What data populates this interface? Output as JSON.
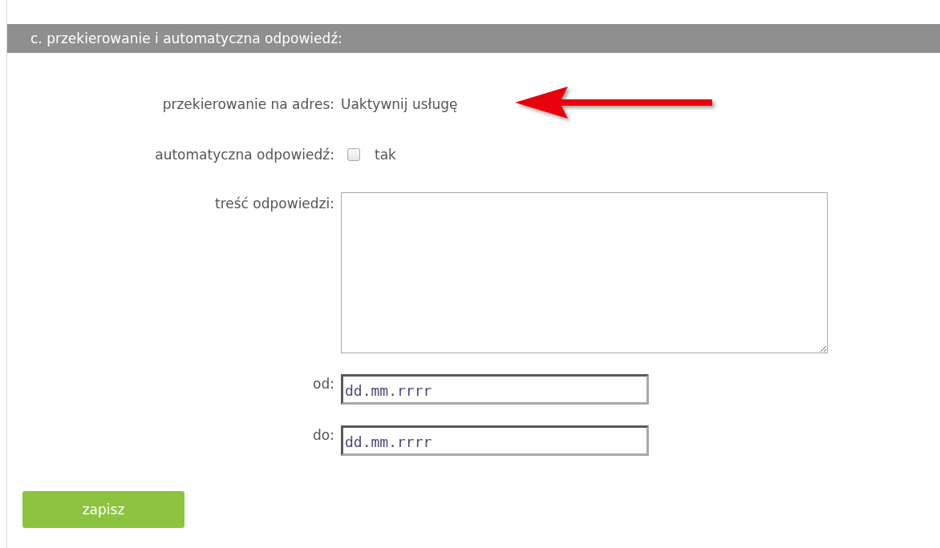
{
  "section": {
    "title": "c. przekierowanie i automatyczna odpowiedź:"
  },
  "fields": [
    {
      "kind": "text",
      "label": "przekierowanie na adres:",
      "value": "Uaktywnij usługę"
    },
    {
      "kind": "checkbox",
      "label": "automatyczna odpowiedź:",
      "checked": false,
      "option": "tak"
    },
    {
      "kind": "textarea",
      "label": "treść odpowiedzi:"
    },
    {
      "kind": "date",
      "label": "od:",
      "value": "dd.mm.rrrr"
    },
    {
      "kind": "date",
      "label": "do:",
      "value": "dd.mm.rrrr"
    }
  ],
  "buttons": [
    {
      "label": "zapisz"
    }
  ]
}
